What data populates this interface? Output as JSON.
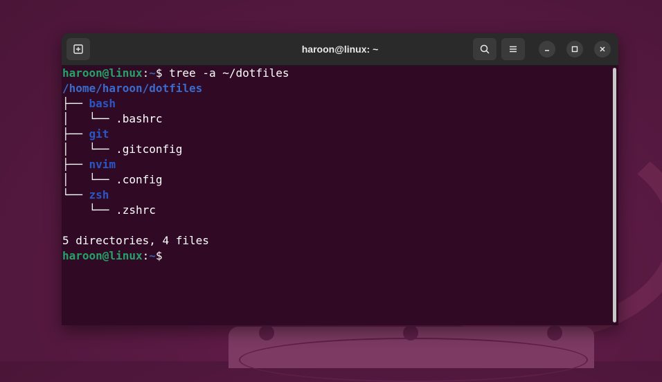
{
  "window": {
    "title": "haroon@linux: ~"
  },
  "terminal": {
    "prompt_user": "haroon@linux",
    "prompt_sep": ":",
    "prompt_path": "~",
    "prompt_symbol": "$",
    "command": " tree -a ~/dotfiles",
    "root": "/home/haroon/dotfiles",
    "tree": [
      {
        "prefix": "├── ",
        "name": "bash",
        "kind": "dir"
      },
      {
        "prefix": "│   └── ",
        "name": ".bashrc",
        "kind": "file"
      },
      {
        "prefix": "├── ",
        "name": "git",
        "kind": "dir"
      },
      {
        "prefix": "│   └── ",
        "name": ".gitconfig",
        "kind": "file"
      },
      {
        "prefix": "├── ",
        "name": "nvim",
        "kind": "dir"
      },
      {
        "prefix": "│   └── ",
        "name": ".config",
        "kind": "file"
      },
      {
        "prefix": "└── ",
        "name": "zsh",
        "kind": "dir"
      },
      {
        "prefix": "    └── ",
        "name": ".zshrc",
        "kind": "file"
      }
    ],
    "summary": "5 directories, 4 files"
  },
  "icons": {
    "new_tab": "new-tab-icon",
    "search": "search-icon",
    "menu": "hamburger-menu-icon",
    "minimize": "minimize-icon",
    "maximize": "maximize-icon",
    "close": "close-icon"
  },
  "colors": {
    "terminal_bg": "#300a24",
    "prompt_user": "#26a269",
    "directory": "#2a56c6"
  }
}
